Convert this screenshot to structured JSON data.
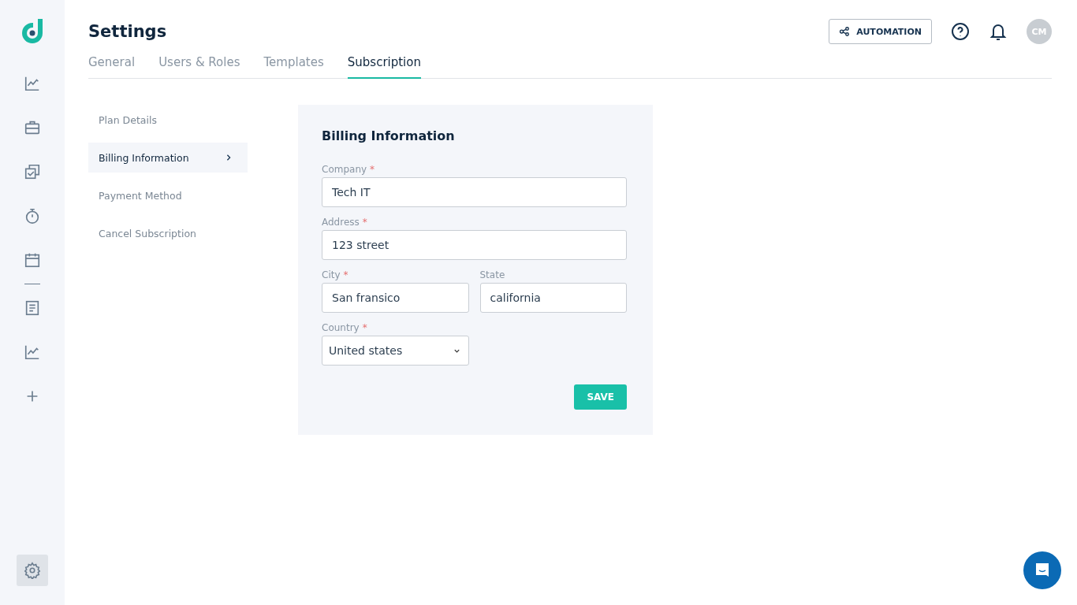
{
  "nav_groups": [
    {
      "items": [
        {
          "kind": "chart",
          "selected": false
        },
        {
          "kind": "briefcase",
          "selected": false
        },
        {
          "kind": "tasks",
          "selected": false
        },
        {
          "kind": "timer",
          "selected": false
        },
        {
          "kind": "calendar",
          "selected": false
        }
      ]
    },
    {
      "items": [
        {
          "kind": "document",
          "selected": false
        },
        {
          "kind": "chart",
          "selected": false
        },
        {
          "kind": "plus",
          "selected": false
        }
      ]
    }
  ],
  "settings_nav": {
    "selected": true
  },
  "header": {
    "title": "Settings",
    "automation_button": "AUTOMATION",
    "avatar": "CM"
  },
  "tabs": [
    {
      "label": "General",
      "selected": false
    },
    {
      "label": "Users & Roles",
      "selected": false
    },
    {
      "label": "Templates",
      "selected": false
    },
    {
      "label": "Subscription",
      "selected": true
    }
  ],
  "submenu": [
    {
      "label": "Plan Details",
      "selected": false
    },
    {
      "label": "Billing Information",
      "selected": true
    },
    {
      "label": "Payment Method",
      "selected": false
    },
    {
      "label": "Cancel Subscription",
      "selected": false
    }
  ],
  "form": {
    "title": "Billing Information",
    "rows": [
      {
        "fields": [
          {
            "kind": "text",
            "label": "Company",
            "required_mark": "*",
            "value": "Tech IT"
          }
        ]
      },
      {
        "fields": [
          {
            "kind": "text",
            "label": "Address",
            "required_mark": "*",
            "value": "123 street"
          }
        ]
      },
      {
        "fields": [
          {
            "kind": "text",
            "label": "City",
            "required_mark": "*",
            "value": "San fransico"
          },
          {
            "kind": "text",
            "label": "State",
            "value": "california"
          }
        ]
      },
      {
        "fields": [
          {
            "kind": "select",
            "label": "Country",
            "required_mark": "*",
            "value": "United states"
          }
        ]
      }
    ],
    "save_button": "SAVE"
  }
}
